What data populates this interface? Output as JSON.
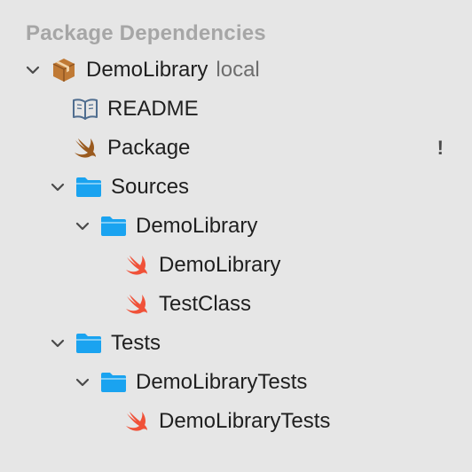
{
  "sidebar": {
    "section_title": "Package Dependencies",
    "tree": [
      {
        "label": "DemoLibrary",
        "suffix": "local",
        "icon": "package-icon",
        "chevron": "chevron-down-icon"
      },
      {
        "label": "README",
        "icon": "book-icon"
      },
      {
        "label": "Package",
        "icon": "swift-icon",
        "badge": "!"
      },
      {
        "label": "Sources",
        "icon": "folder-icon",
        "chevron": "chevron-down-icon"
      },
      {
        "label": "DemoLibrary",
        "icon": "folder-icon",
        "chevron": "chevron-down-icon"
      },
      {
        "label": "DemoLibrary",
        "icon": "swift-icon"
      },
      {
        "label": "TestClass",
        "icon": "swift-icon"
      },
      {
        "label": "Tests",
        "icon": "folder-icon",
        "chevron": "chevron-down-icon"
      },
      {
        "label": "DemoLibraryTests",
        "icon": "folder-icon",
        "chevron": "chevron-down-icon"
      },
      {
        "label": "DemoLibraryTests",
        "icon": "swift-icon"
      }
    ]
  },
  "colors": {
    "background": "#e6e6e6",
    "folder": "#1aa3f0",
    "swift": "#f05138",
    "package": "#b8722c",
    "section_header": "#a6a6a6"
  }
}
